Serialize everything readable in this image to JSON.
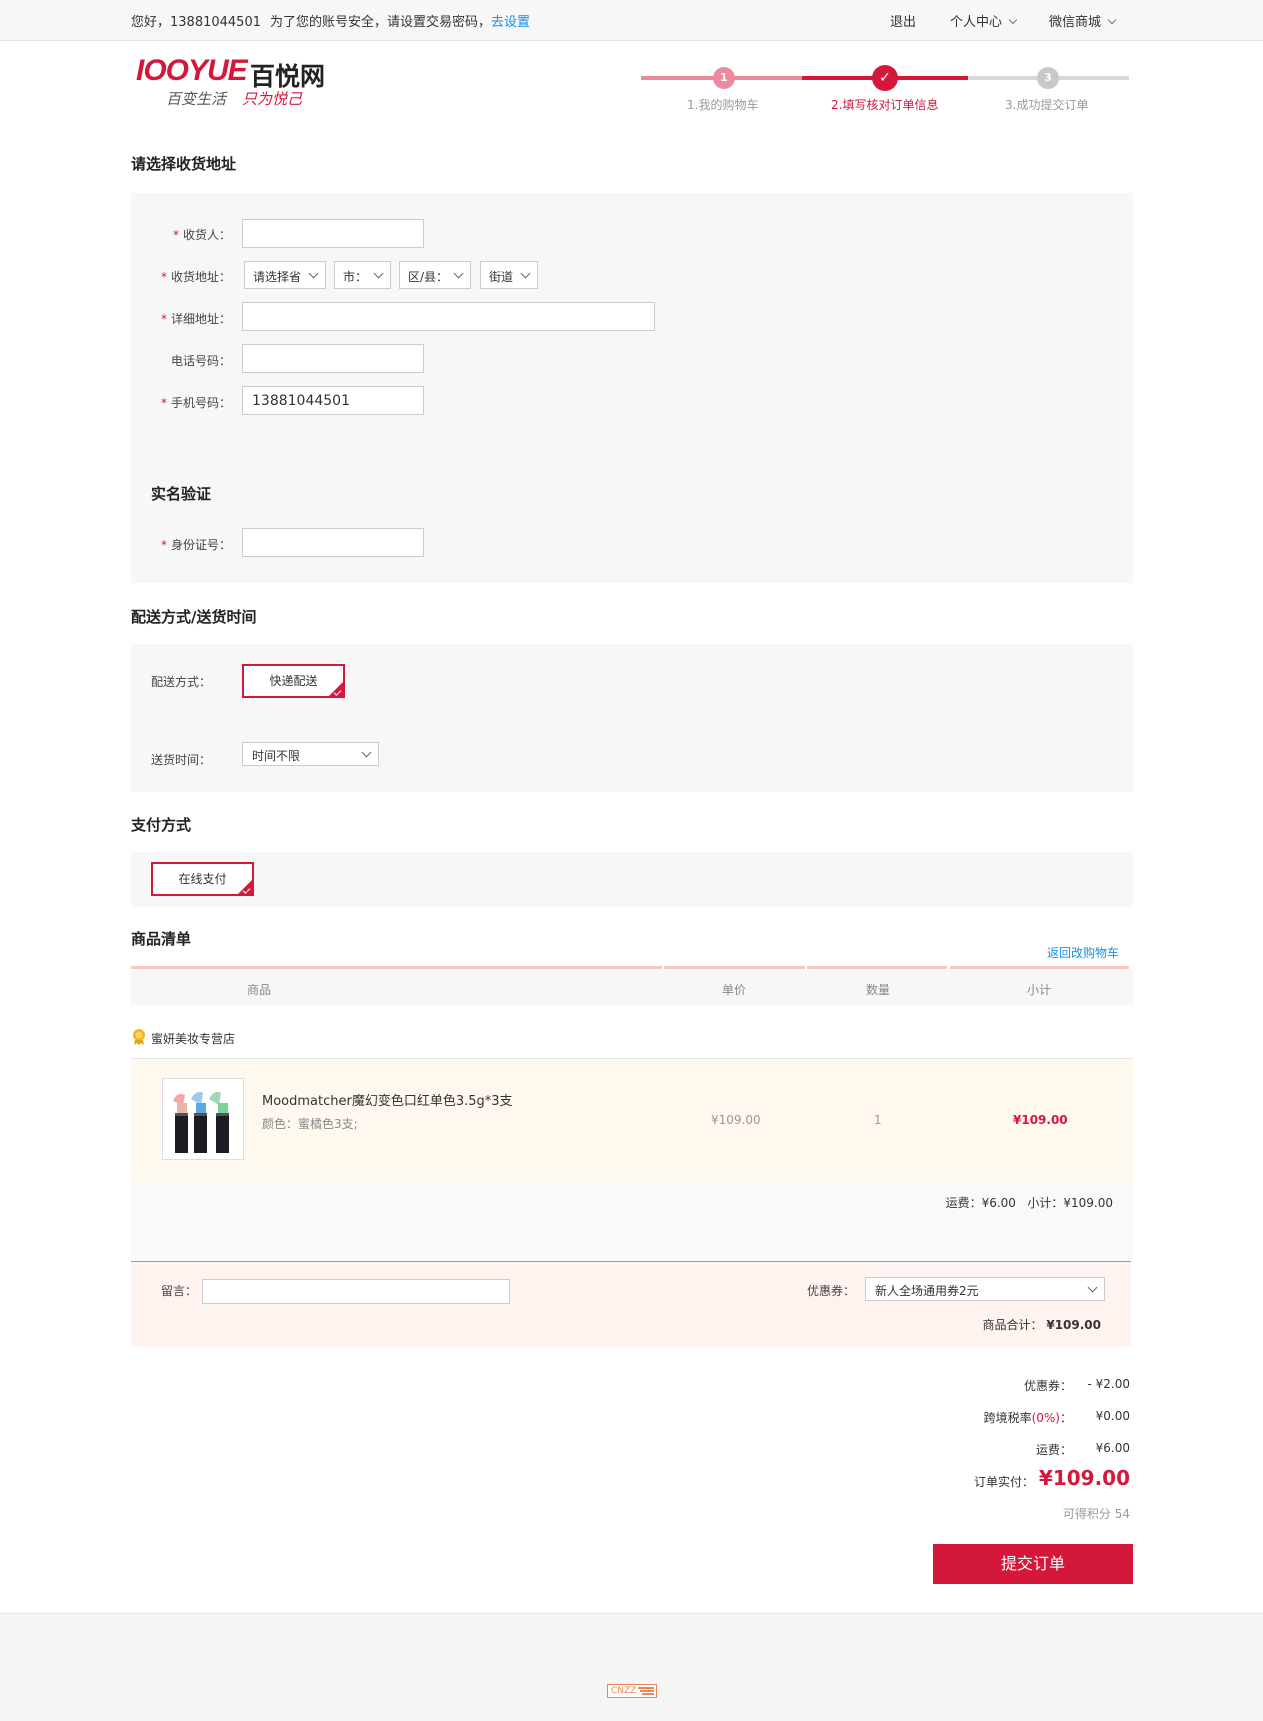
{
  "topbar": {
    "greeting": "您好，13881044501",
    "security_text": "为了您的账号安全，请设置交易密码，",
    "security_link": "去设置",
    "logout": "退出",
    "personal_center": "个人中心",
    "wechat_mall": "微信商城"
  },
  "logo": {
    "brand": "IOOYUE",
    "name_cn": "百悦网",
    "slogan_1": "百变生活",
    "slogan_2": "只为悦己"
  },
  "steps": [
    {
      "num": "1",
      "label": "1.我的购物车"
    },
    {
      "num": "✓",
      "label": "2.填写核对订单信息"
    },
    {
      "num": "3",
      "label": "3.成功提交订单"
    }
  ],
  "address": {
    "title": "请选择收货地址",
    "receiver_label": "收货人：",
    "region_label": "收货地址：",
    "province": "请选择省",
    "city": "市：",
    "district": "区/县：",
    "street": "街道",
    "detail_label": "详细地址：",
    "phone_label": "电话号码：",
    "mobile_label": "手机号码：",
    "mobile_value": "13881044501",
    "verify_title": "实名验证",
    "id_label": "身份证号："
  },
  "delivery": {
    "title": "配送方式/送货时间",
    "method_label": "配送方式：",
    "method_value": "快递配送",
    "time_label": "送货时间：",
    "time_value": "时间不限"
  },
  "payment": {
    "title": "支付方式",
    "method": "在线支付"
  },
  "goods": {
    "title": "商品清单",
    "back_link": "返回改购物车",
    "headers": [
      "商品",
      "单价",
      "数量",
      "小计"
    ],
    "shop_name": "蜜妍美妆专营店",
    "item": {
      "name": "Moodmatcher魔幻变色口红单色3.5g*3支",
      "spec": "颜色：蜜橘色3支;",
      "price": "¥109.00",
      "qty": "1",
      "subtotal": "¥109.00"
    },
    "shipping_summary": "运费：¥6.00   小计：¥109.00"
  },
  "order": {
    "remark_label": "留言：",
    "coupon_label": "优惠券：",
    "coupon_value": "新人全场通用券2元",
    "goods_total_label": "商品合计：",
    "goods_total_value": "¥109.00"
  },
  "summary": {
    "coupon_label": "优惠券：",
    "coupon_value": "- ¥2.00",
    "tax_label": "跨境税率",
    "tax_rate": "(0%)",
    "tax_colon": "：",
    "tax_value": "¥0.00",
    "ship_label": "运费：",
    "ship_value": "¥6.00",
    "pay_label": "订单实付：",
    "pay_value": "¥109.00",
    "points": "可得积分 54"
  },
  "submit_label": "提交订单",
  "footer": {
    "badge": "CNZZ"
  },
  "colors": {
    "accent": "#d3183c",
    "link": "#1a8ee0"
  }
}
